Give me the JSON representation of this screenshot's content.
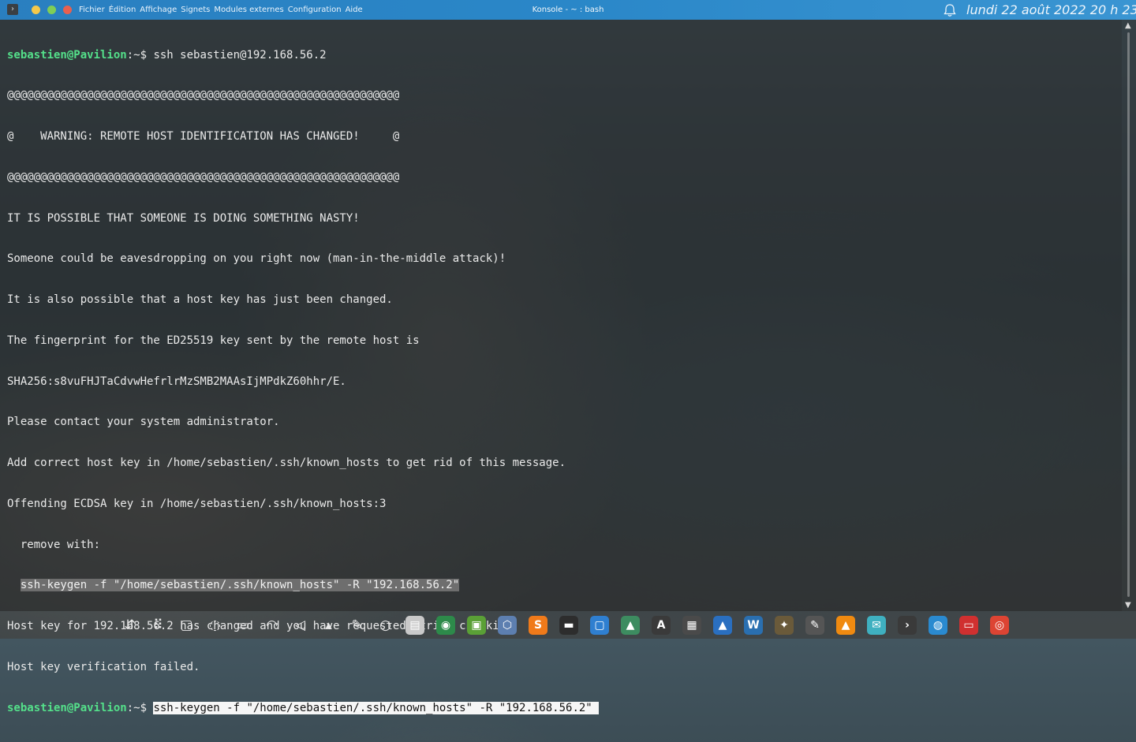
{
  "titlebar": {
    "menu": [
      "Fichier",
      "Édition",
      "Affichage",
      "Signets",
      "Modules externes",
      "Configuration",
      "Aide"
    ],
    "window_title": "Konsole - ~ : bash",
    "clock": "lundi 22 août 2022  20 h 23"
  },
  "terminal": {
    "prompt_user": "sebastien@Pavilion",
    "prompt_suffix": ":~$ ",
    "command_1": "ssh sebastien@192.168.56.2",
    "line_banner_1": "@@@@@@@@@@@@@@@@@@@@@@@@@@@@@@@@@@@@@@@@@@@@@@@@@@@@@@@@@@@",
    "line_banner_2": "@    WARNING: REMOTE HOST IDENTIFICATION HAS CHANGED!     @",
    "line_banner_3": "@@@@@@@@@@@@@@@@@@@@@@@@@@@@@@@@@@@@@@@@@@@@@@@@@@@@@@@@@@@",
    "line_1": "IT IS POSSIBLE THAT SOMEONE IS DOING SOMETHING NASTY!",
    "line_2": "Someone could be eavesdropping on you right now (man-in-the-middle attack)!",
    "line_3": "It is also possible that a host key has just been changed.",
    "line_4": "The fingerprint for the ED25519 key sent by the remote host is",
    "line_5": "SHA256:s8vuFHJTaCdvwHefrlrMzSMB2MAAsIjMPdkZ60hhr/E.",
    "line_6": "Please contact your system administrator.",
    "line_7": "Add correct host key in /home/sebastien/.ssh/known_hosts to get rid of this message.",
    "line_8": "Offending ECDSA key in /home/sebastien/.ssh/known_hosts:3",
    "line_9": "  remove with:",
    "line_10": "ssh-keygen -f \"/home/sebastien/.ssh/known_hosts\" -R \"192.168.56.2\"",
    "line_11": "Host key for 192.168.56.2 has changed and you have requested strict checking.",
    "line_12": "Host key verification failed.",
    "command_2": "ssh-keygen -f \"/home/sebastien/.ssh/known_hosts\" -R \"192.168.56.2\" "
  },
  "taskbar": {
    "tray_icons": [
      "network-share-icon",
      "app-grid-icon",
      "desktop-icon",
      "lightbulb-icon",
      "battery-icon",
      "wifi-icon",
      "volume-icon",
      "tray-expand-icon",
      "pen-icon",
      "circle-icon"
    ],
    "app_icons": [
      {
        "name": "files-app-icon",
        "glyph": "▤",
        "color": "#c9c9c9"
      },
      {
        "name": "globe-app-icon",
        "glyph": "◉",
        "color": "#2d8a4a"
      },
      {
        "name": "android-app-icon",
        "glyph": "▣",
        "color": "#5aa036"
      },
      {
        "name": "virtualbox-app-icon",
        "glyph": "⬡",
        "color": "#5d7fb0"
      },
      {
        "name": "sublime-app-icon",
        "glyph": "S",
        "color": "#f07a1a"
      },
      {
        "name": "terminal-app-icon",
        "glyph": "▬",
        "color": "#2d2d2d"
      },
      {
        "name": "screenshot-app-icon",
        "glyph": "▢",
        "color": "#2f7fd0"
      },
      {
        "name": "system-monitor-app-icon",
        "glyph": "▲",
        "color": "#3d8c60"
      },
      {
        "name": "font-app-icon",
        "glyph": "A",
        "color": "#3a3a3a"
      },
      {
        "name": "calculator-app-icon",
        "glyph": "▦",
        "color": "#4a4a4a"
      },
      {
        "name": "store-app-icon",
        "glyph": "▲",
        "color": "#2a6fc0"
      },
      {
        "name": "writer-app-icon",
        "glyph": "W",
        "color": "#2a6fb0"
      },
      {
        "name": "gimp-app-icon",
        "glyph": "✦",
        "color": "#6a5a3a"
      },
      {
        "name": "pencil-app-icon",
        "glyph": "✎",
        "color": "#555555"
      },
      {
        "name": "vlc-app-icon",
        "glyph": "▲",
        "color": "#f08a10"
      },
      {
        "name": "mail-app-icon",
        "glyph": "✉",
        "color": "#3fb0c0"
      },
      {
        "name": "konsole-app-icon",
        "glyph": "›",
        "color": "#3a3a3a"
      },
      {
        "name": "network-app-icon",
        "glyph": "◍",
        "color": "#2a8ad0"
      },
      {
        "name": "folder-red-app-icon",
        "glyph": "▭",
        "color": "#d03030"
      },
      {
        "name": "chrome-app-icon",
        "glyph": "◎",
        "color": "#dd4433"
      }
    ]
  }
}
